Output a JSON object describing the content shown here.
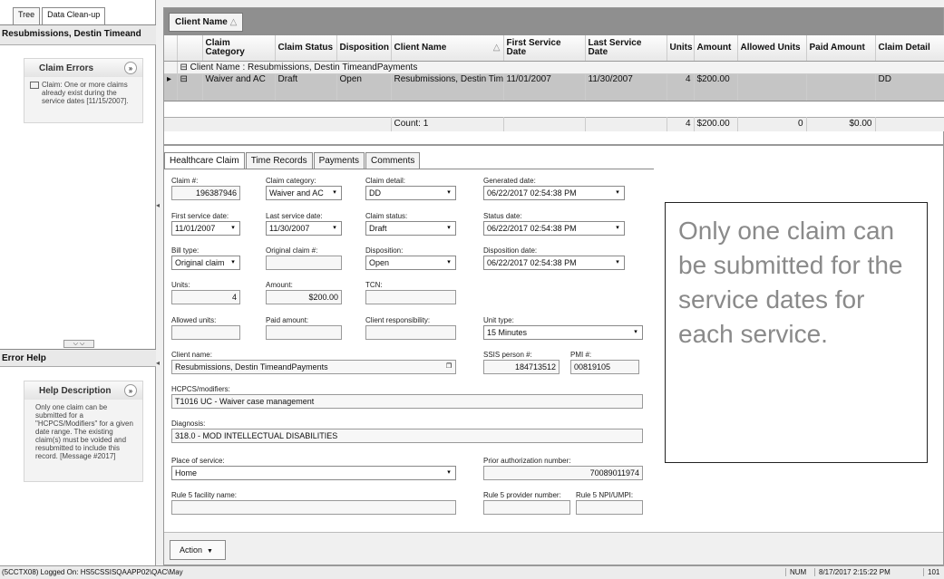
{
  "left": {
    "tabs": [
      "Tree",
      "Data Clean-up"
    ],
    "header": "Resubmissions, Destin Timeand",
    "claim_errors": {
      "title": "Claim Errors",
      "toggle": "»",
      "message": "Claim: One or more claims already exist during the service dates [11/15/2007]."
    },
    "splitter": "⌵ ⌵",
    "error_help": {
      "title": "Error Help",
      "help_title": "Help Description",
      "toggle": "»",
      "text": "Only one claim can be submitted for a \"HCPCS/Modifiers\" for a given date range. The existing claim(s) must be voided and resubmitted to include this record. [Message #2017]"
    },
    "collapse_arrow": "◂"
  },
  "grid": {
    "group_chip": "Client Name",
    "group_sort": "△",
    "columns": [
      "Claim Category",
      "Claim Status",
      "Disposition",
      "Client Name",
      "First Service Date",
      "Last Service Date",
      "Units",
      "Amount",
      "Allowed Units",
      "Paid Amount",
      "Claim Detail"
    ],
    "group_row": "Client Name : Resubmissions, Destin TimeandPayments",
    "group_expander": "⊟",
    "row": {
      "category": "Waiver and AC",
      "status": "Draft",
      "disposition": "Open",
      "client": "Resubmissions, Destin TimeandPayments",
      "first": "11/01/2007",
      "last": "11/30/2007",
      "units": "4",
      "amount": "$200.00",
      "allowed": "",
      "paid": "",
      "detail": "DD"
    },
    "row_indicator": "▸",
    "count": "Count: 1",
    "totals": {
      "units": "4",
      "amount": "$200.00",
      "allowed": "0",
      "paid": "$0.00"
    }
  },
  "tabs": [
    "Healthcare Claim",
    "Time Records",
    "Payments",
    "Comments"
  ],
  "form": {
    "claim_no": {
      "label": "Claim #:",
      "value": "196387946"
    },
    "claim_category": {
      "label": "Claim category:",
      "value": "Waiver and AC"
    },
    "claim_detail": {
      "label": "Claim detail:",
      "value": "DD"
    },
    "generated_date": {
      "label": "Generated date:",
      "value": "06/22/2017 02:54:38 PM"
    },
    "first_service_date": {
      "label": "First service date:",
      "value": "11/01/2007"
    },
    "last_service_date": {
      "label": "Last service date:",
      "value": "11/30/2007"
    },
    "claim_status": {
      "label": "Claim status:",
      "value": "Draft"
    },
    "status_date": {
      "label": "Status date:",
      "value": "06/22/2017 02:54:38 PM"
    },
    "bill_type": {
      "label": "Bill type:",
      "value": "Original claim"
    },
    "original_claim": {
      "label": "Original claim #:",
      "value": ""
    },
    "disposition": {
      "label": "Disposition:",
      "value": "Open"
    },
    "disposition_date": {
      "label": "Disposition date:",
      "value": "06/22/2017 02:54:38 PM"
    },
    "units": {
      "label": "Units:",
      "value": "4"
    },
    "amount": {
      "label": "Amount:",
      "value": "$200.00"
    },
    "tcn": {
      "label": "TCN:",
      "value": ""
    },
    "allowed_units": {
      "label": "Allowed units:",
      "value": ""
    },
    "paid_amount": {
      "label": "Paid amount:",
      "value": ""
    },
    "client_responsibility": {
      "label": "Client responsibility:",
      "value": ""
    },
    "unit_type": {
      "label": "Unit type:",
      "value": "15 Minutes"
    },
    "client_name": {
      "label": "Client name:",
      "value": "Resubmissions, Destin TimeandPayments"
    },
    "ssis_person": {
      "label": "SSIS person #:",
      "value": "184713512"
    },
    "pmi": {
      "label": "PMI #:",
      "value": "00819105"
    },
    "hcpcs": {
      "label": "HCPCS/modifiers:",
      "value": "T1016 UC - Waiver case management"
    },
    "diagnosis": {
      "label": "Diagnosis:",
      "value": "318.0 - MOD INTELLECTUAL DISABILITIES"
    },
    "place_of_service": {
      "label": "Place of service:",
      "value": "Home"
    },
    "prior_auth": {
      "label": "Prior authorization number:",
      "value": "70089011974"
    },
    "rule5_facility": {
      "label": "Rule 5 facility name:",
      "value": ""
    },
    "rule5_provider": {
      "label": "Rule 5 provider number:",
      "value": ""
    },
    "rule5_npi": {
      "label": "Rule 5 NPI/UMPI:",
      "value": ""
    },
    "dropdown_glyph": "▾",
    "browse_glyph": "❐"
  },
  "note": "Only one claim can be submitted for the service dates for each service.",
  "action": {
    "label": "Action",
    "arrow": "▼"
  },
  "status_bar": {
    "left": "(5CCTX08) Logged On: HS5CSSISQAAPP02\\QAC\\May",
    "num": "NUM",
    "datetime": "8/17/2017 2:15:22 PM",
    "right": "101"
  }
}
